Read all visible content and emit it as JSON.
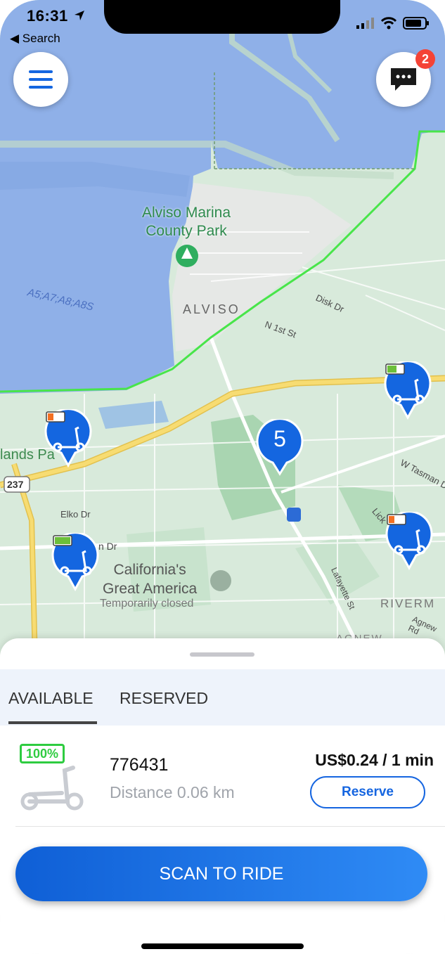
{
  "status": {
    "time": "16:31",
    "back_label": "◀ Search"
  },
  "header": {
    "menu_icon": "hamburger-icon",
    "messages_icon": "chat-bubble-icon",
    "messages_badge": "2"
  },
  "map": {
    "labels": {
      "park": "Alviso Marina\nCounty Park",
      "water": "A5;A7;A8;A8S",
      "town": "ALVISO",
      "disk_dr": "Disk Dr",
      "n1st": "N 1st St",
      "lands_park": "lands Pa",
      "route": "237",
      "elko": "Elko Dr",
      "n_dr": "n Dr",
      "tasman": "W Tasman Dr",
      "lick": "Lick",
      "great_america": "California's\nGreat America",
      "temp_closed": "Temporarily closed",
      "lafayette": "Lafayette St",
      "riverm": "RIVERM",
      "agnew_rd": "Agnew Rd",
      "agnew": "AGNEW"
    },
    "cluster_count": "5",
    "colors": {
      "water": "#8fb0e8",
      "land": "#d9ebdd",
      "green": "#a8d5b0",
      "road": "#f6d86b",
      "zone": "#48e54a",
      "pin": "#1466e0"
    }
  },
  "sheet": {
    "tabs": [
      {
        "label": "AVAILABLE",
        "active": true
      },
      {
        "label": "RESERVED",
        "active": false
      }
    ],
    "vehicle": {
      "battery": "100%",
      "id": "776431",
      "distance": "Distance 0.06 km",
      "price": "US$0.24 / 1 min",
      "reserve_label": "Reserve"
    },
    "scan_label": "SCAN TO RIDE"
  }
}
